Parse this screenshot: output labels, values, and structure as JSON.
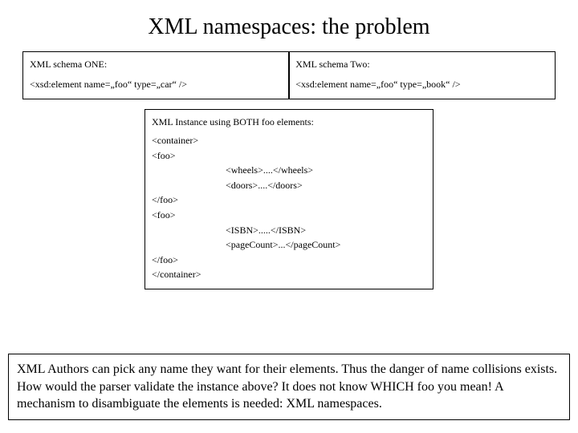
{
  "title": "XML namespaces: the problem",
  "schema_one": {
    "label": "XML schema ONE:",
    "decl": "<xsd:element name=„foo“ type=„car“ />"
  },
  "schema_two": {
    "label": "XML schema Two:",
    "decl": "<xsd:element name=„foo“ type=„book“ />"
  },
  "instance": {
    "header": "XML Instance using BOTH foo elements:",
    "lines": {
      "l0": "<container>",
      "l1": "<foo>",
      "l2": "<wheels>....</wheels>",
      "l3": "<doors>....</doors>",
      "l4": "</foo>",
      "l5": "<foo>",
      "l6": "<ISBN>.....</ISBN>",
      "l7": "<pageCount>...</pageCount>",
      "l8": "</foo>",
      "l9": "</container>"
    }
  },
  "note": "XML Authors can pick any name they want for their elements. Thus the danger of name collisions exists. How would the parser validate the instance above? It does not know WHICH foo you mean! A mechanism to disambiguate the elements is needed: XML namespaces."
}
